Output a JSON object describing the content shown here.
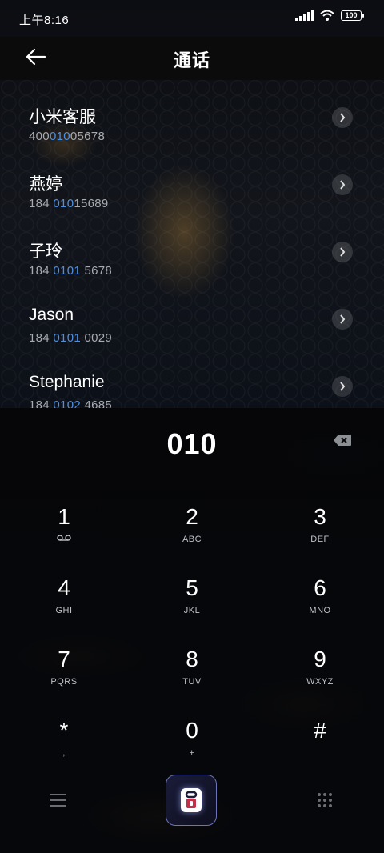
{
  "status_bar": {
    "time": "上午8:16",
    "battery": "100"
  },
  "header": {
    "title": "通话"
  },
  "contacts": [
    {
      "name": "小米客服",
      "number_pre": "400",
      "number_hl": "010",
      "number_post": "05678"
    },
    {
      "name": "燕婷",
      "number_pre": "184 ",
      "number_hl": "010",
      "number_post": "15689"
    },
    {
      "name": "子玲",
      "number_pre": "184 ",
      "number_hl": "0101",
      "number_post": " 5678"
    },
    {
      "name": "Jason",
      "number_pre": "184 ",
      "number_hl": "0101",
      "number_post": " 0029"
    },
    {
      "name": "Stephanie",
      "number_pre": "184 ",
      "number_hl": "0102",
      "number_post": " 4685"
    }
  ],
  "dialer": {
    "input": "010",
    "keys": [
      {
        "digit": "1",
        "letters": ""
      },
      {
        "digit": "2",
        "letters": "ABC"
      },
      {
        "digit": "3",
        "letters": "DEF"
      },
      {
        "digit": "4",
        "letters": "GHI"
      },
      {
        "digit": "5",
        "letters": "JKL"
      },
      {
        "digit": "6",
        "letters": "MNO"
      },
      {
        "digit": "7",
        "letters": "PQRS"
      },
      {
        "digit": "8",
        "letters": "TUV"
      },
      {
        "digit": "9",
        "letters": "WXYZ"
      },
      {
        "digit": "*",
        "letters": ","
      },
      {
        "digit": "0",
        "letters": "+"
      },
      {
        "digit": "#",
        "letters": ""
      }
    ]
  },
  "colors": {
    "highlight": "#4f8fe0",
    "secondary_text": "#a8abb0",
    "header_bg": "#0b0b0c"
  },
  "icons": {
    "back": "arrow-left-icon",
    "voicemail": "voicemail-icon",
    "backspace": "backspace-icon",
    "menu": "menu-icon",
    "call": "call-icon",
    "keypad": "keypad-icon",
    "chevron": "chevron-right-icon"
  }
}
